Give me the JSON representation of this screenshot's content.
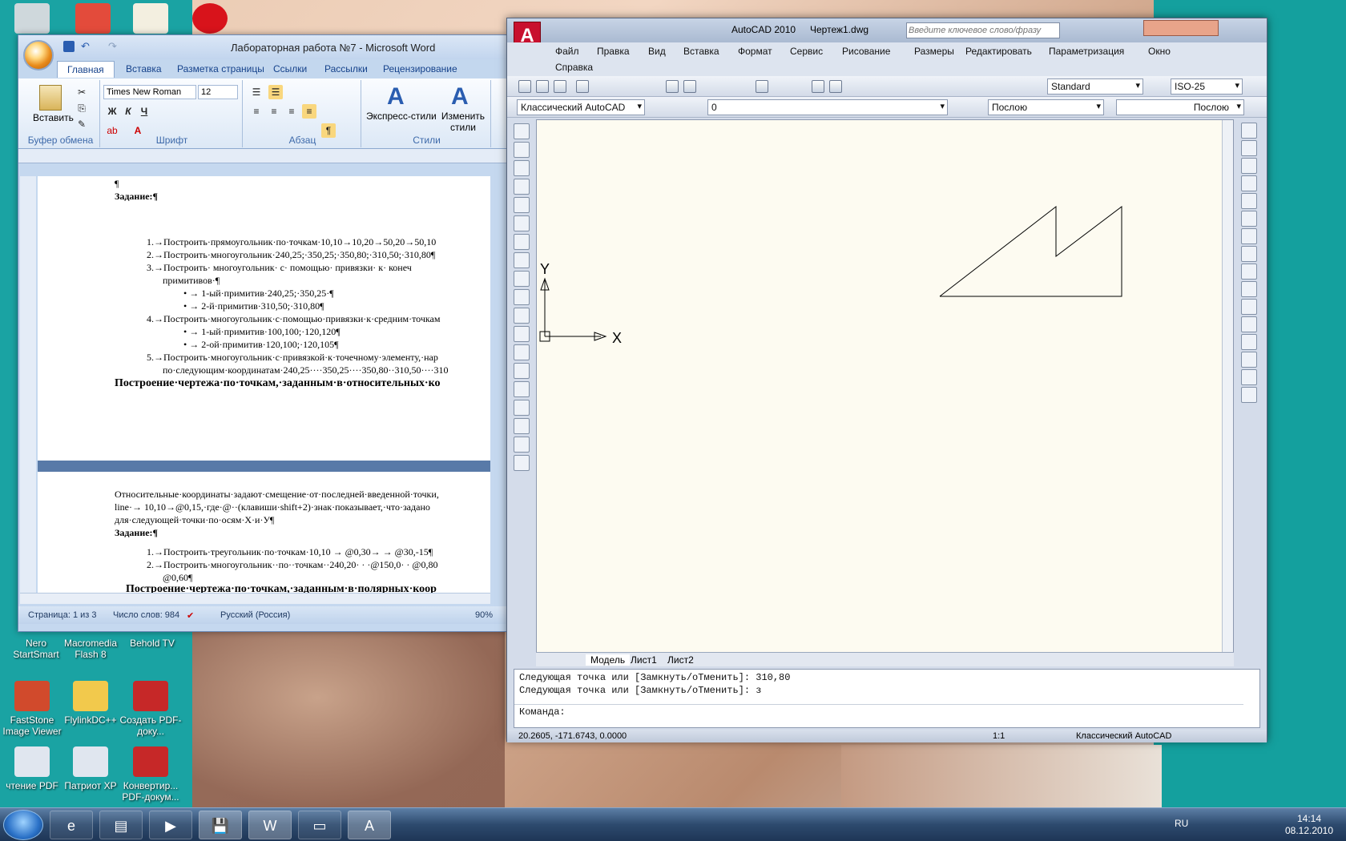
{
  "desktop": {
    "icons": [
      {
        "label": "Nero StartSmart"
      },
      {
        "label": "Macromedia Flash 8"
      },
      {
        "label": "Behold TV"
      },
      {
        "label": "FastStone Image Viewer"
      },
      {
        "label": "FlylinkDC++"
      },
      {
        "label": "Создать PDF-доку..."
      },
      {
        "label": "чтение PDF"
      },
      {
        "label": "Патриот XP"
      },
      {
        "label": "Конвертир... PDF-докум..."
      }
    ]
  },
  "word": {
    "title": "Лабораторная работа №7 - Microsoft Word",
    "tabs": [
      "Главная",
      "Вставка",
      "Разметка страницы",
      "Ссылки",
      "Рассылки",
      "Рецензирование"
    ],
    "ribbon": {
      "paste_label": "Вставить",
      "font_name": "Times New Roman",
      "font_size": "12",
      "groups": [
        "Буфер обмена",
        "Шрифт",
        "Абзац",
        "Стили"
      ],
      "express_styles": "Экспресс-стили",
      "change_styles": "Изменить стили",
      "bold": "Ж",
      "italic": "К",
      "underline": "Ч"
    },
    "document": {
      "lines": [
        "¶",
        "Задание:¶",
        "1.→Построить·прямоугольник·по·точкам·10,10→10,20→50,20→50,10",
        "2.→Построить·многоугольник·240,25;·350,25;·350,80;·310,50;·310,80¶",
        "3.→Построить·  многоугольник·  с·  помощью·  привязки·  к·  конеч",
        "примитивов·¶",
        "•  →  1-ый·примитив·240,25;·350,25·¶",
        "•  →  2-й·примитив·310,50;·310,80¶",
        "4.→Построить·многоугольник·с·помощью·привязки·к·средним·точкам",
        "•  →  1-ый·примитив·100,100;·120,120¶",
        "•  →  2-ой·примитив·120,100;·120,105¶",
        "5.→Построить·многоугольник·с·привязкой·к·точечному·элементу,·нар",
        "по·следующим·координатам·240,25····350,25····350,80··310,50····310",
        "Построение·чертежа·по·точкам,·заданным·в·относительных·ко"
      ],
      "lines2": [
        "Относительные·координаты·задают·смещение·от·последней·введенной·точки,",
        "line·→  10,10→@0,15,·где·@··(клавиши·shift+2)·знак·показывает,·что·задано",
        "для·следующей·точки·по·осям·Х·и·У¶",
        "Задание:¶",
        "1.→Построить·треугольник·по·точкам·10,10   →   @0,30→   →    @30,-15¶",
        "2.→Построить·многоугольник··по··точкам··240,20·  ·  ·@150,0·  ·  @0,80",
        "@0,60¶",
        "Построение·чертежа·по·точкам,·заданным·в·полярных·коор"
      ]
    },
    "status": {
      "page": "Страница: 1 из 3",
      "words": "Число слов: 984",
      "lang": "Русский (Россия)",
      "zoom": "90%"
    }
  },
  "acad": {
    "app": "AutoCAD 2010",
    "file": "Чертеж1.dwg",
    "search_placeholder": "Введите ключевое слово/фразу",
    "menu": [
      "Файл",
      "Правка",
      "Вид",
      "Вставка",
      "Формат",
      "Сервис",
      "Рисование",
      "Размеры",
      "Редактировать",
      "Параметризация",
      "Окно",
      "Справка"
    ],
    "text_style": "Standard",
    "dim_style": "ISO-25",
    "workspace": "Классический AutoCAD",
    "layer": "0",
    "color": "Послою",
    "linetype": "Послою",
    "tabs": [
      "Модель",
      "Лист1",
      "Лист2"
    ],
    "axis_x": "X",
    "axis_y": "Y",
    "cmd_lines": [
      "Следующая точка или [Замкнуть/оТменить]: 310,80",
      "Следующая точка или [Замкнуть/оТменить]: з",
      "Команда:"
    ],
    "coords": "20.2605, -171.6743, 0.0000",
    "scale": "1:1",
    "status_workspace": "Классический AutoCAD"
  },
  "taskbar": {
    "lang": "RU",
    "time": "14:14",
    "date": "08.12.2010"
  }
}
